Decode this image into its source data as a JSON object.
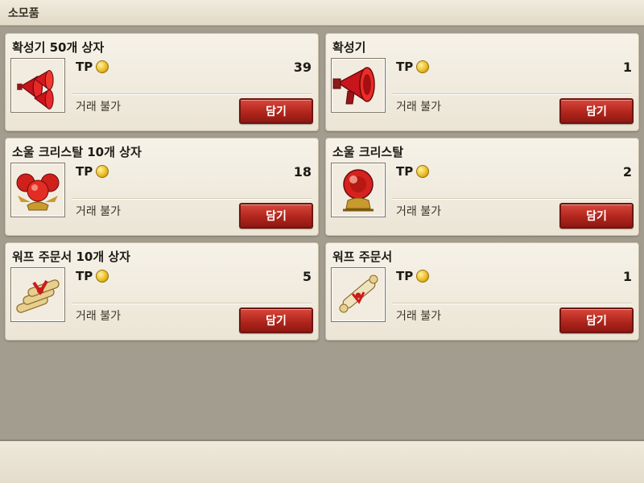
{
  "header": {
    "title": "소모품"
  },
  "currency": {
    "label": "TP",
    "icon": "tp-coin-icon"
  },
  "items": [
    {
      "name": "확성기 50개 상자",
      "price": "39",
      "trade": "거래 불가",
      "button": "담기",
      "icon": "megaphone-bundle-icon"
    },
    {
      "name": "확성기",
      "price": "1",
      "trade": "거래 불가",
      "button": "담기",
      "icon": "megaphone-icon"
    },
    {
      "name": "소울 크리스탈 10개 상자",
      "price": "18",
      "trade": "거래 불가",
      "button": "담기",
      "icon": "soul-crystal-bundle-icon"
    },
    {
      "name": "소울 크리스탈",
      "price": "2",
      "trade": "거래 불가",
      "button": "담기",
      "icon": "soul-crystal-icon"
    },
    {
      "name": "워프 주문서 10개 상자",
      "price": "5",
      "trade": "거래 불가",
      "button": "담기",
      "icon": "warp-scroll-bundle-icon"
    },
    {
      "name": "워프 주문서",
      "price": "1",
      "trade": "거래 불가",
      "button": "담기",
      "icon": "warp-scroll-icon"
    }
  ],
  "colors": {
    "button": "#b1261d",
    "panel": "#a39d8f",
    "card": "#f3eee3"
  }
}
